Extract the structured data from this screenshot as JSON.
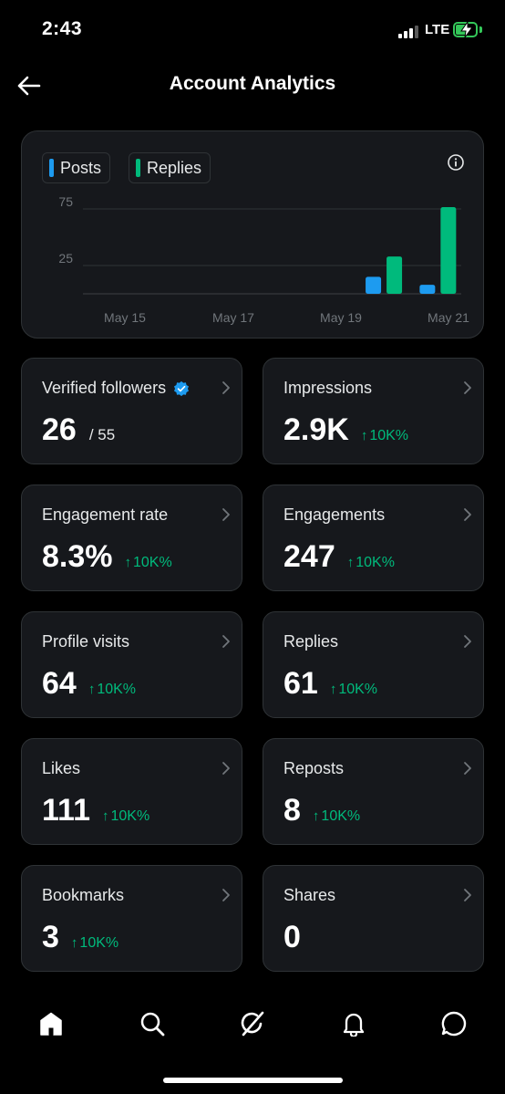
{
  "status": {
    "time": "2:43",
    "network": "LTE"
  },
  "header": {
    "title": "Account Analytics"
  },
  "chart_data": {
    "type": "bar",
    "legend": [
      {
        "name": "Posts",
        "color": "#1d9bf0"
      },
      {
        "name": "Replies",
        "color": "#00ba7c"
      }
    ],
    "x_ticks": [
      "May 15",
      "May 17",
      "May 19",
      "May 21"
    ],
    "y_ticks": [
      75,
      25
    ],
    "categories": [
      "May 15",
      "May 16",
      "May 17",
      "May 18",
      "May 19",
      "May 20",
      "May 21"
    ],
    "series": [
      {
        "name": "Posts",
        "values": [
          0,
          0,
          0,
          0,
          0,
          15,
          8
        ]
      },
      {
        "name": "Replies",
        "values": [
          0,
          0,
          0,
          0,
          0,
          33,
          88
        ]
      }
    ],
    "ylim": [
      0,
      75
    ],
    "grid": true
  },
  "metrics": [
    {
      "label": "Verified followers",
      "value": "26",
      "sub": "/ 55",
      "change": "",
      "verified": true
    },
    {
      "label": "Impressions",
      "value": "2.9K",
      "sub": "",
      "change": "10K%"
    },
    {
      "label": "Engagement rate",
      "value": "8.3%",
      "sub": "",
      "change": "10K%"
    },
    {
      "label": "Engagements",
      "value": "247",
      "sub": "",
      "change": "10K%"
    },
    {
      "label": "Profile visits",
      "value": "64",
      "sub": "",
      "change": "10K%"
    },
    {
      "label": "Replies",
      "value": "61",
      "sub": "",
      "change": "10K%"
    },
    {
      "label": "Likes",
      "value": "111",
      "sub": "",
      "change": "10K%"
    },
    {
      "label": "Reposts",
      "value": "8",
      "sub": "",
      "change": "10K%"
    },
    {
      "label": "Bookmarks",
      "value": "3",
      "sub": "",
      "change": "10K%"
    },
    {
      "label": "Shares",
      "value": "0",
      "sub": "",
      "change": ""
    }
  ],
  "nav": [
    {
      "name": "home",
      "icon": "home-icon",
      "active": true
    },
    {
      "name": "search",
      "icon": "search-icon"
    },
    {
      "name": "grok",
      "icon": "grok-icon"
    },
    {
      "name": "notifications",
      "icon": "bell-icon"
    },
    {
      "name": "messages",
      "icon": "message-icon"
    }
  ]
}
